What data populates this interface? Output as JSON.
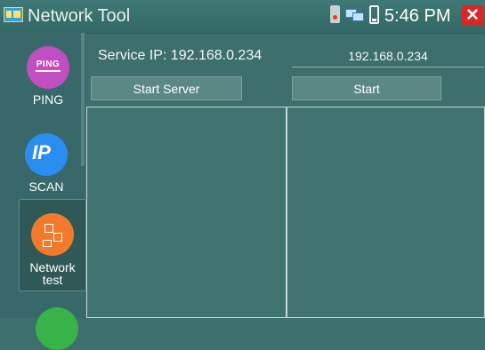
{
  "header": {
    "title": "Network Tool",
    "time": "5:46 PM",
    "close_symbol": "✕"
  },
  "sidebar": {
    "items": [
      {
        "label": "PING",
        "icon_name": "ping-icon",
        "icon_text": "PING",
        "color": "#c24fc2"
      },
      {
        "label": "SCAN",
        "icon_name": "ip-scan-icon",
        "icon_text": "IP",
        "color": "#2a8ef0"
      },
      {
        "label": "Network test",
        "icon_name": "network-test-icon",
        "color": "#f27b2b",
        "selected": true
      },
      {
        "label": "",
        "icon_name": "green-tool-icon",
        "color": "#37b34a"
      }
    ]
  },
  "server": {
    "service_ip_label": "Service IP: 192.168.0.234",
    "start_server_label": "Start Server",
    "output": ""
  },
  "client": {
    "ip_value": "192.168.0.234",
    "start_label": "Start",
    "output": ""
  },
  "colors": {
    "background": "#3d6f6d",
    "sidebar": "#38686a",
    "close": "#d92626"
  }
}
